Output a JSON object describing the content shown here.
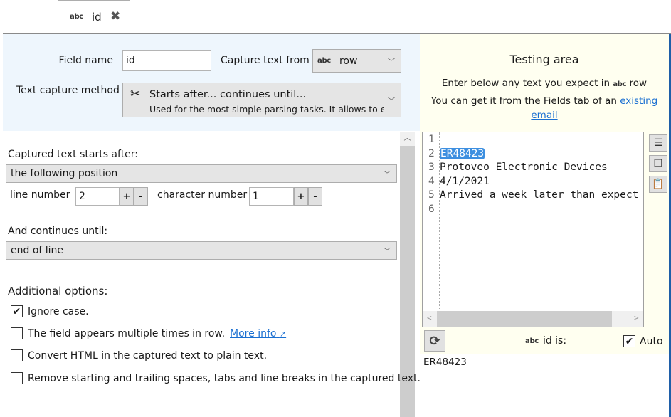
{
  "tab": {
    "type_icon": "abc",
    "label": "id",
    "close_icon": "close-icon"
  },
  "header": {
    "field_name_label": "Field name",
    "field_name_value": "id",
    "capture_from_label": "Capture text from",
    "capture_from_icon": "abc",
    "capture_from_value": "row",
    "method_label": "Text capture method",
    "method_icon": "scissors-icon",
    "method_title": "Starts after... continues until...",
    "method_desc": "Used for the most simple parsing tasks. It allows to ext"
  },
  "start": {
    "label": "Captured text starts after:",
    "value": "the following position",
    "line_label": "line number",
    "line_value": "2",
    "char_label": "character number",
    "char_value": "1",
    "plus": "+",
    "minus": "-"
  },
  "end": {
    "label": "And continues until:",
    "value": "end of line"
  },
  "options": {
    "title": "Additional options:",
    "items": [
      {
        "label": "Ignore case.",
        "checked": true
      },
      {
        "label": "The field appears multiple times in row.",
        "checked": false,
        "link": "More info"
      },
      {
        "label": "Convert HTML in the captured text to plain text.",
        "checked": false
      },
      {
        "label": "Remove starting and trailing spaces, tabs and line breaks in the captured text.",
        "checked": false
      }
    ]
  },
  "testing": {
    "title": "Testing area",
    "line1": "Enter below any text you expect in",
    "line1_icon": "abc",
    "line1_field": "row",
    "line2": "You can get it from the Fields tab of an",
    "link": "existing email",
    "lines": [
      {
        "n": "1",
        "text": ""
      },
      {
        "n": "2",
        "text": "ER48423",
        "highlight": true
      },
      {
        "n": "3",
        "text": "Protoveo Electronic Devices"
      },
      {
        "n": "4",
        "text": "4/1/2021"
      },
      {
        "n": "5",
        "text": "Arrived a week later than expect"
      },
      {
        "n": "6",
        "text": ""
      }
    ],
    "result_icon": "abc",
    "result_label": "id is:",
    "auto_label": "Auto",
    "auto_checked": true,
    "result_value": "ER48423"
  }
}
